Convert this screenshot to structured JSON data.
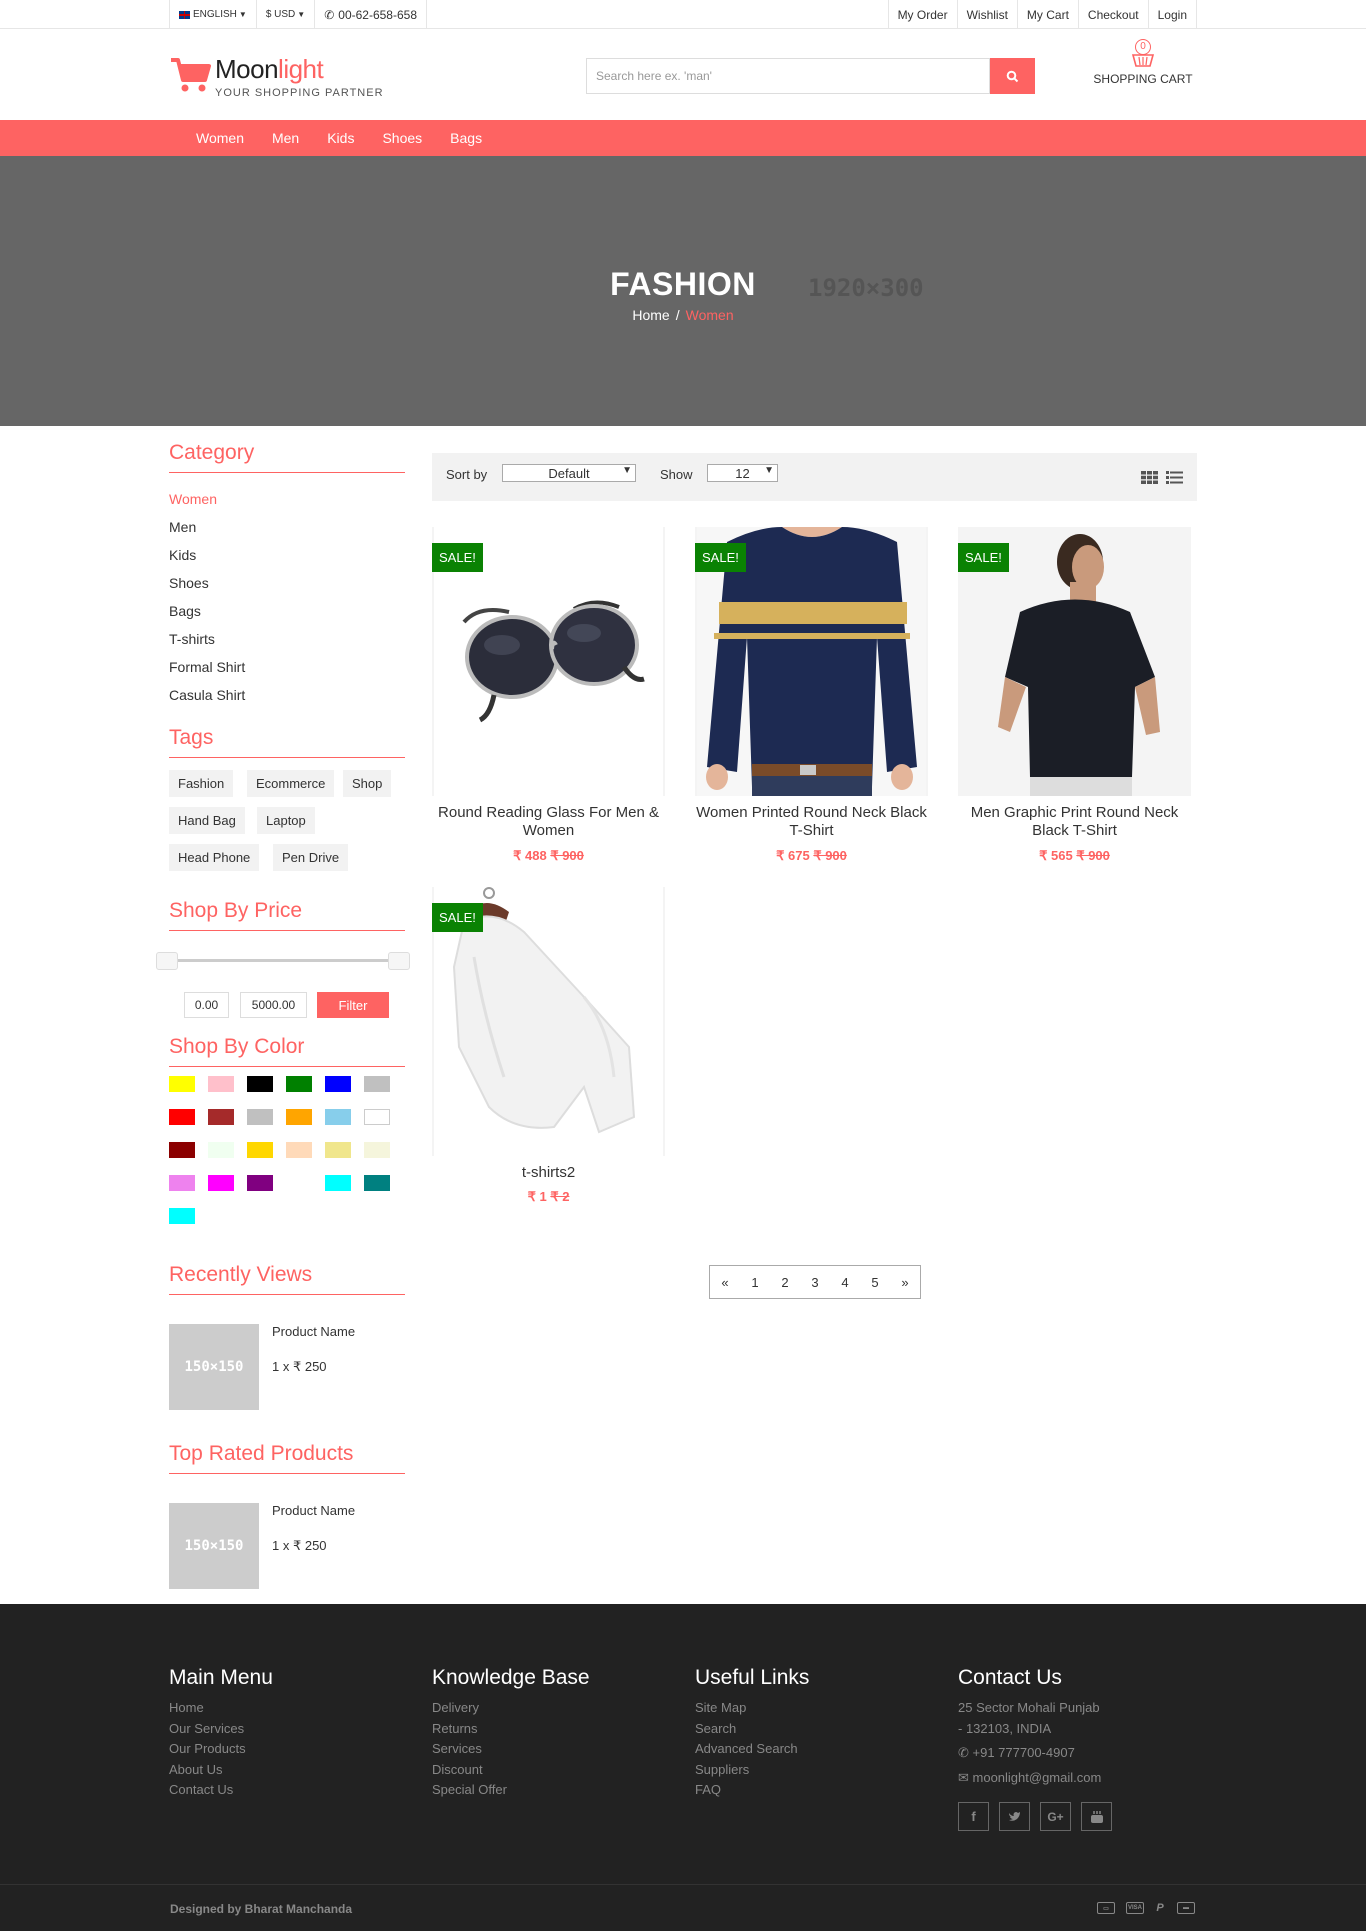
{
  "topbar": {
    "language": "ENGLISH",
    "currency": "$ USD",
    "phone": "00-62-658-658",
    "links": [
      "My Order",
      "Wishlist",
      "My Cart",
      "Checkout",
      "Login"
    ]
  },
  "header": {
    "logo_main": "Moon",
    "logo_accent": "light",
    "tagline": "YOUR SHOPPING PARTNER",
    "search_placeholder": "Search here ex. 'man'",
    "cart_count": "0",
    "cart_label": "SHOPPING CART"
  },
  "nav": [
    "Women",
    "Men",
    "Kids",
    "Shoes",
    "Bags"
  ],
  "banner": {
    "title": "FASHION",
    "crumb_home": "Home",
    "crumb_sep": "/",
    "crumb_current": "Women",
    "placeholder_size": "1920×300"
  },
  "sidebar": {
    "category_title": "Category",
    "categories": [
      "Women",
      "Men",
      "Kids",
      "Shoes",
      "Bags",
      "T-shirts",
      "Formal Shirt",
      "Casula Shirt"
    ],
    "tags_title": "Tags",
    "tags": [
      "Fashion",
      "Ecommerce",
      "Shop",
      "Hand Bag",
      "Laptop",
      "Head Phone",
      "Pen Drive"
    ],
    "price_title": "Shop By Price",
    "price_min": "0.00",
    "price_max": "5000.00",
    "filter_label": "Filter",
    "color_title": "Shop By Color",
    "colors": [
      "#ffff00",
      "#ffc0cb",
      "#000000",
      "#008000",
      "#0000ff",
      "#c0c0c0",
      "#ff0000",
      "#a52a2a",
      "#c0c0c0",
      "#ffa500",
      "#87ceeb",
      "#ffffff",
      "#8b0000",
      "#f0fff0",
      "#ffd700",
      "#ffdab9",
      "#f0e68c",
      "#f5f5dc",
      "#ee82ee",
      "#ff00ff",
      "#800080",
      "",
      "#00ffff",
      "#008080",
      "#00ffff"
    ],
    "recent_title": "Recently Views",
    "recent_thumb": "150×150",
    "recent_name": "Product Name",
    "recent_price": "1 x ₹ 250",
    "top_title": "Top Rated Products",
    "top_thumb": "150×150",
    "top_name": "Product Name",
    "top_price": "1 x ₹ 250"
  },
  "toolbar": {
    "sort_label": "Sort by",
    "sort_value": "Default",
    "show_label": "Show",
    "show_value": "12",
    "grid_icon": "grid-icon",
    "list_icon": "list-icon"
  },
  "products": [
    {
      "badge": "SALE!",
      "name": "Round Reading Glass For Men & Women",
      "price": "₹ 488",
      "old_price": "₹ 900",
      "image": "sunglasses"
    },
    {
      "badge": "SALE!",
      "name": "Women Printed Round Neck Black T-Shirt",
      "price": "₹ 675",
      "old_price": "₹ 900",
      "image": "striped-tshirt"
    },
    {
      "badge": "SALE!",
      "name": "Men Graphic Print Round Neck Black T-Shirt",
      "price": "₹ 565",
      "old_price": "₹ 900",
      "image": "black-polo"
    },
    {
      "badge": "SALE!",
      "name": "t-shirts2",
      "price": "₹ 1",
      "old_price": "₹ 2",
      "image": "white-sweatshirt"
    }
  ],
  "pager": [
    "«",
    "1",
    "2",
    "3",
    "4",
    "5",
    "»"
  ],
  "footer": {
    "cols": [
      {
        "title": "Main Menu",
        "items": [
          "Home",
          "Our Services",
          "Our Products",
          "About Us",
          "Contact Us"
        ]
      },
      {
        "title": "Knowledge Base",
        "items": [
          "Delivery",
          "Returns",
          "Services",
          "Discount",
          "Special Offer"
        ]
      },
      {
        "title": "Useful Links",
        "items": [
          "Site Map",
          "Search",
          "Advanced Search",
          "Suppliers",
          "FAQ"
        ]
      }
    ],
    "contact_title": "Contact Us",
    "address_line1": "25 Sector Mohali Punjab",
    "address_line2": "- 132103, INDIA",
    "phone": "+91 777700-4907",
    "email": "moonlight@gmail.com",
    "socials": [
      "facebook-icon",
      "twitter-icon",
      "google-plus-icon",
      "youtube-icon"
    ],
    "credit": "Designed by Bharat Manchanda",
    "payments": [
      "card-icon",
      "visa-icon",
      "paypal-icon",
      "credit-card-icon"
    ]
  },
  "colors": {
    "accent": "#fe6362",
    "sale": "#0a8203",
    "banner": "#666666",
    "footer": "#222222"
  }
}
